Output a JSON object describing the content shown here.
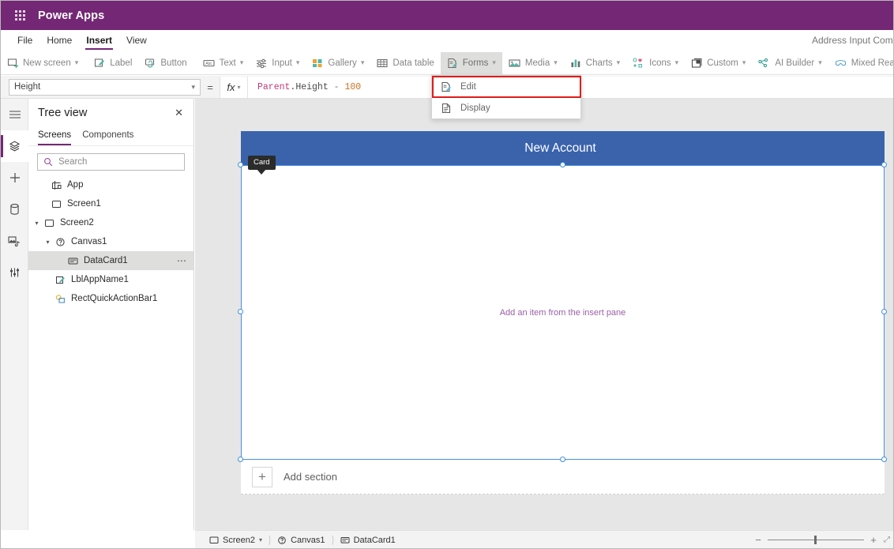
{
  "topbar": {
    "waffle_icon": "waffle-grid-icon",
    "brand": "Power Apps"
  },
  "menustrip": {
    "items": [
      {
        "label": "File",
        "active": false
      },
      {
        "label": "Home",
        "active": false
      },
      {
        "label": "Insert",
        "active": true
      },
      {
        "label": "View",
        "active": false
      }
    ],
    "app_name": "Address Input Comp"
  },
  "ribbon": {
    "items": [
      {
        "label": "New screen",
        "icon": "new-screen-icon",
        "caret": true
      },
      {
        "label": "Label",
        "icon": "label-icon",
        "caret": false
      },
      {
        "label": "Button",
        "icon": "button-icon",
        "caret": false
      },
      {
        "label": "Text",
        "icon": "text-icon",
        "caret": true
      },
      {
        "label": "Input",
        "icon": "input-icon",
        "caret": true
      },
      {
        "label": "Gallery",
        "icon": "gallery-icon",
        "caret": true
      },
      {
        "label": "Data table",
        "icon": "data-table-icon",
        "caret": false
      },
      {
        "label": "Forms",
        "icon": "forms-icon",
        "caret": true,
        "selected": true
      },
      {
        "label": "Media",
        "icon": "media-icon",
        "caret": true
      },
      {
        "label": "Charts",
        "icon": "charts-icon",
        "caret": true
      },
      {
        "label": "Icons",
        "icon": "icons-icon",
        "caret": true
      },
      {
        "label": "Custom",
        "icon": "custom-icon",
        "caret": true
      },
      {
        "label": "AI Builder",
        "icon": "ai-builder-icon",
        "caret": true
      },
      {
        "label": "Mixed Reality",
        "icon": "mixed-reality-icon",
        "caret": true
      }
    ]
  },
  "dropdown": {
    "items": [
      {
        "label": "Edit",
        "icon": "form-edit-icon",
        "highlighted": true
      },
      {
        "label": "Display",
        "icon": "form-display-icon",
        "highlighted": false
      }
    ],
    "highlight_color": "#e01b1b"
  },
  "formula_bar": {
    "property": "Height",
    "equals": "=",
    "fx_label": "fx",
    "formula": {
      "identifier": "Parent",
      "dot": ".",
      "property": "Height",
      "operator": "-",
      "number": "100"
    }
  },
  "rail": {
    "items": [
      {
        "name": "hamburger-icon",
        "active": false
      },
      {
        "name": "tree-view-icon",
        "active": true
      },
      {
        "name": "insert-plus-icon",
        "active": false
      },
      {
        "name": "data-icon",
        "active": false
      },
      {
        "name": "media-library-icon",
        "active": false
      },
      {
        "name": "advanced-settings-icon",
        "active": false
      }
    ]
  },
  "treeview": {
    "title": "Tree view",
    "close_icon": "close-icon",
    "tabs": [
      {
        "label": "Screens",
        "active": true
      },
      {
        "label": "Components",
        "active": false
      }
    ],
    "search_placeholder": "Search",
    "search_icon": "search-icon",
    "nodes": [
      {
        "label": "App",
        "indent": 0,
        "icon": "app-icon",
        "chev": "",
        "selected": false,
        "more": false
      },
      {
        "label": "Screen1",
        "indent": 0,
        "icon": "screen-icon",
        "chev": "",
        "selected": false,
        "more": false
      },
      {
        "label": "Screen2",
        "indent": 0,
        "icon": "screen-icon",
        "chev": "v",
        "selected": false,
        "more": false
      },
      {
        "label": "Canvas1",
        "indent": 1,
        "icon": "canvas-icon",
        "chev": "v",
        "selected": false,
        "more": false
      },
      {
        "label": "DataCard1",
        "indent": 2,
        "icon": "datacard-icon",
        "chev": "",
        "selected": true,
        "more": true
      },
      {
        "label": "LblAppName1",
        "indent": 1,
        "icon": "label-node-icon",
        "chev": "",
        "selected": false,
        "more": false
      },
      {
        "label": "RectQuickActionBar1",
        "indent": 1,
        "icon": "rect-node-icon",
        "chev": "",
        "selected": false,
        "more": false
      }
    ]
  },
  "canvas": {
    "app_header_title": "New Account",
    "app_header_color": "#3a63ac",
    "card_badge": "Card",
    "form_placeholder": "Add an item from the insert pane",
    "form_placeholder_color": "#9b5fa8",
    "selection_color": "#3f8fdf",
    "add_section_label": "Add section",
    "add_section_icon": "plus-icon"
  },
  "statusbar": {
    "breadcrumb": [
      {
        "label": "Screen2",
        "icon": "screen-icon",
        "caret": true
      },
      {
        "label": "Canvas1",
        "icon": "canvas-icon",
        "caret": false
      },
      {
        "label": "DataCard1",
        "icon": "datacard-icon",
        "caret": false
      }
    ],
    "zoom_minus": "−",
    "zoom_plus": "+",
    "zoom_more": "⤢"
  }
}
